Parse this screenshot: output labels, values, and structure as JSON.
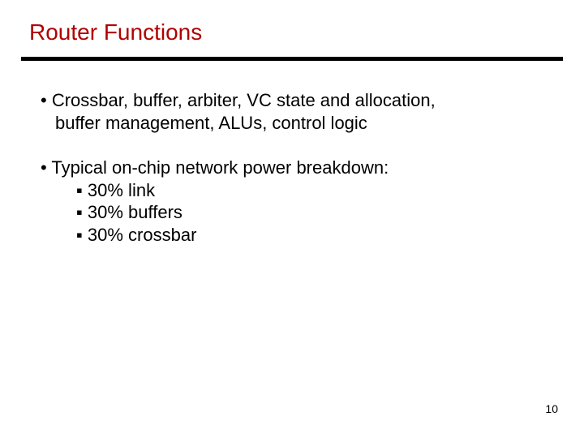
{
  "title": "Router Functions",
  "bullet1": {
    "line1": "• Crossbar, buffer, arbiter, VC state and allocation,",
    "line2": "buffer management, ALUs, control logic"
  },
  "bullet2": {
    "head": "• Typical on-chip network power breakdown:",
    "sub1": "▪ 30% link",
    "sub2": "▪ 30% buffers",
    "sub3": "▪ 30% crossbar"
  },
  "page_number": "10"
}
